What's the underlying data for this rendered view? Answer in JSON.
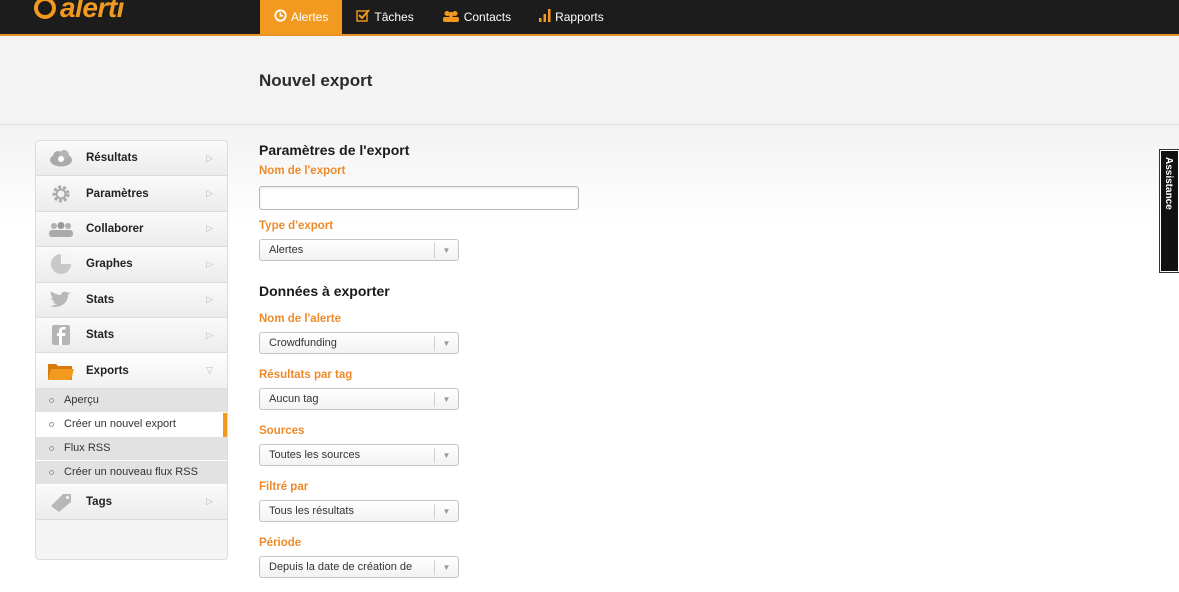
{
  "app": {
    "logo_text": "alerti"
  },
  "nav": {
    "items": [
      {
        "label": "Alertes",
        "icon": "clock-icon",
        "active": true
      },
      {
        "label": "Tâches",
        "icon": "checkbox-icon",
        "active": false
      },
      {
        "label": "Contacts",
        "icon": "people-icon",
        "active": false
      },
      {
        "label": "Rapports",
        "icon": "bar-chart-icon",
        "active": false
      }
    ]
  },
  "page": {
    "title": "Nouvel export"
  },
  "sidebar": {
    "items": [
      {
        "label": "Résultats",
        "icon": "cloud-icon"
      },
      {
        "label": "Paramètres",
        "icon": "gear-icon"
      },
      {
        "label": "Collaborer",
        "icon": "people-icon"
      },
      {
        "label": "Graphes",
        "icon": "pie-chart-icon"
      },
      {
        "label": "Stats",
        "icon": "twitter-bird-icon"
      },
      {
        "label": "Stats",
        "icon": "facebook-icon"
      },
      {
        "label": "Exports",
        "icon": "folder-icon"
      },
      {
        "label": "Tags",
        "icon": "tag-icon"
      }
    ],
    "submenu": [
      {
        "label": "Aperçu",
        "active": false
      },
      {
        "label": "Créer un nouvel export",
        "active": true
      },
      {
        "label": "Flux RSS",
        "active": false
      },
      {
        "label": "Créer un nouveau flux RSS",
        "active": false
      }
    ]
  },
  "form": {
    "section1_title": "Paramètres de l'export",
    "name_label": "Nom de l'export",
    "name_value": "",
    "type_label": "Type d'export",
    "type_value": "Alertes",
    "section2_title": "Données à exporter",
    "alert_label": "Nom de l'alerte",
    "alert_value": "Crowdfunding",
    "tag_label": "Résultats par tag",
    "tag_value": "Aucun tag",
    "sources_label": "Sources",
    "sources_value": "Toutes les sources",
    "filter_label": "Filtré par",
    "filter_value": "Tous les résultats",
    "period_label": "Période",
    "period_value": "Depuis la date de création de"
  },
  "assistance": {
    "label": "Assistance"
  },
  "colors": {
    "accent": "#f29a1f",
    "label_orange": "#ee8a2a",
    "topbar": "#1c1c1c"
  }
}
